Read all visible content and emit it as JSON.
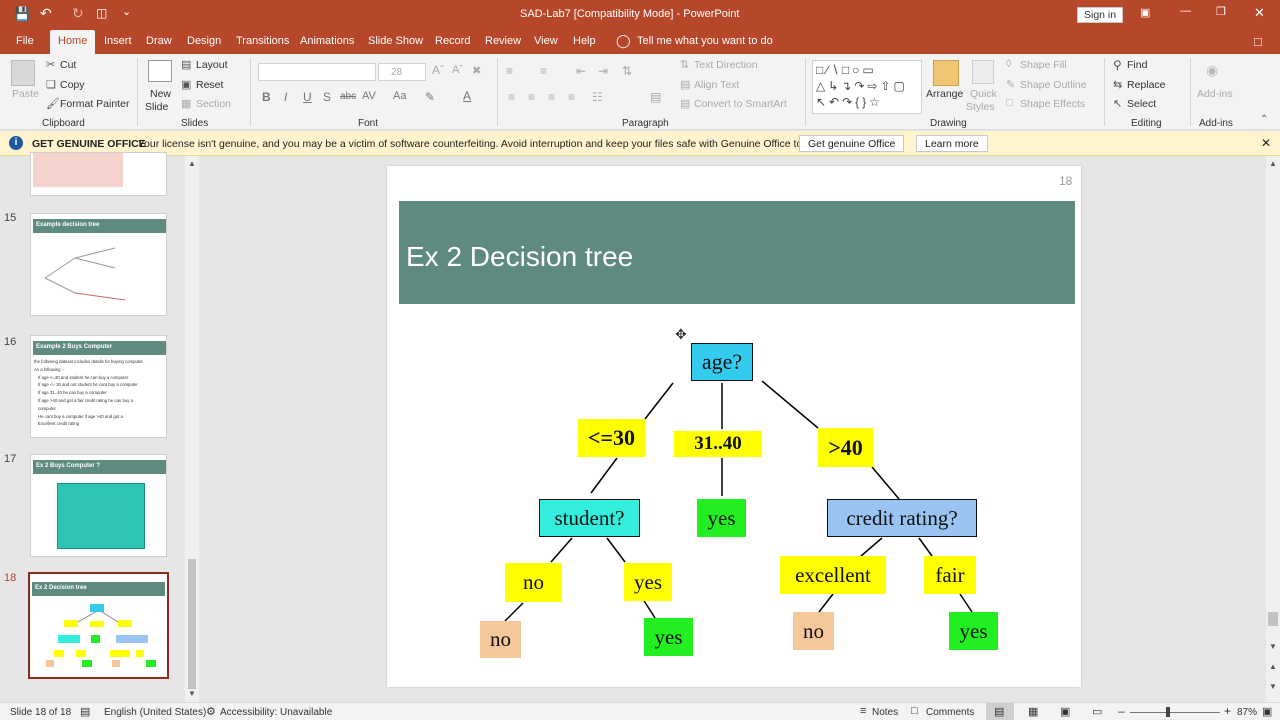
{
  "window": {
    "title": "SAD-Lab7 [Compatibility Mode]  -  PowerPoint",
    "signin": "Sign in"
  },
  "tabs": [
    "File",
    "Home",
    "Insert",
    "Draw",
    "Design",
    "Transitions",
    "Animations",
    "Slide Show",
    "Record",
    "Review",
    "View",
    "Help"
  ],
  "tell_me": "Tell me what you want to do",
  "ribbon": {
    "clipboard": {
      "paste": "Paste",
      "cut": "Cut",
      "copy": "Copy",
      "format_painter": "Format Painter",
      "label": "Clipboard"
    },
    "slides": {
      "new_slide_1": "New",
      "new_slide_2": "Slide",
      "layout": "Layout",
      "reset": "Reset",
      "section": "Section",
      "label": "Slides"
    },
    "font": {
      "size": "28",
      "label": "Font"
    },
    "paragraph": {
      "text_direction": "Text Direction",
      "align_text": "Align Text",
      "convert": "Convert to SmartArt",
      "label": "Paragraph"
    },
    "drawing": {
      "arrange": "Arrange",
      "quick": "Quick",
      "styles": "Styles",
      "shape_fill": "Shape Fill",
      "shape_outline": "Shape Outline",
      "shape_effects": "Shape Effects",
      "label": "Drawing"
    },
    "editing": {
      "find": "Find",
      "replace": "Replace",
      "select": "Select",
      "label": "Editing"
    },
    "addins": {
      "btn": "Add-ins",
      "label": "Add-ins"
    }
  },
  "license": {
    "title": "GET GENUINE OFFICE",
    "message": "Your license isn't genuine, and you may be a victim of software counterfeiting. Avoid interruption and keep your files safe with Genuine Office today.",
    "btn1": "Get genuine Office",
    "btn2": "Learn more"
  },
  "thumbnails": [
    {
      "num": "15",
      "title": "Example decision tree"
    },
    {
      "num": "16",
      "title": "Example 2 Buys Computer",
      "lines": [
        "the following dataset includes details for buying computer",
        "As a following :-",
        "If age <=30 and student he can buy a computer",
        "If age <= 30 and not student he cant buy a computer",
        "If age 31..40 he can buy a computer",
        "If age >40 and got a fair credit rating he can buy a",
        "computer",
        "He cant buy a computer if age >40 and got a",
        "Excellent credit rating"
      ]
    },
    {
      "num": "17",
      "title": "Ex 2  Buys Computer ?"
    },
    {
      "num": "18",
      "title": "Ex 2  Decision tree"
    }
  ],
  "slide": {
    "number": "18",
    "title": "Ex 2  Decision tree",
    "tree": {
      "root": "age?",
      "le30": "<=30",
      "mid": "31..40",
      "gt40": ">40",
      "student": "student?",
      "yes_mid": "yes",
      "credit": "credit rating?",
      "no_edge": "no",
      "yes_edge": "yes",
      "excellent": "excellent",
      "fair": "fair",
      "leaf_no": "no",
      "leaf_yes": "yes",
      "leaf_no2": "no",
      "leaf_yes2": "yes"
    },
    "colors": {
      "header": "#5f8a80",
      "root": "#33ccee",
      "student": "#33eedd",
      "credit": "#99c4f2",
      "edge_label": "#ffff00",
      "leaf_no": "#f4c79a",
      "leaf_yes": "#22ee22"
    }
  },
  "status": {
    "slide": "Slide 18 of 18",
    "lang": "English (United States)",
    "access": "Accessibility: Unavailable",
    "notes": "Notes",
    "comments": "Comments",
    "zoom": "87%"
  }
}
